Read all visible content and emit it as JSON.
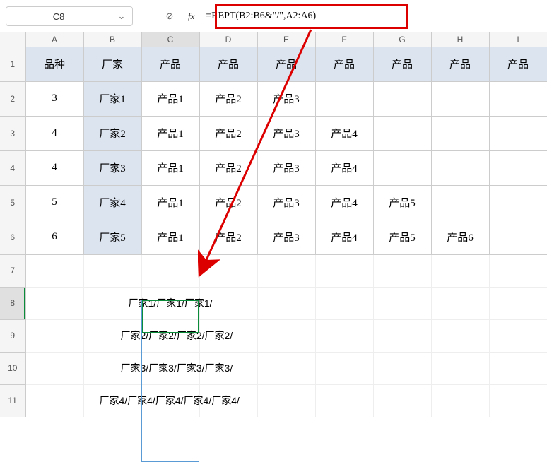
{
  "toolbar": {
    "cell_ref": "C8",
    "fx_label": "fx",
    "formula": "=REPT(B2:B6&\"/\",A2:A6)"
  },
  "columns": [
    "A",
    "B",
    "C",
    "D",
    "E",
    "F",
    "G",
    "H",
    "I"
  ],
  "rows": [
    "1",
    "2",
    "3",
    "4",
    "5",
    "6",
    "7",
    "8",
    "9",
    "10",
    "11"
  ],
  "headers": {
    "A": "品种",
    "B": "厂家",
    "C": "产品",
    "D": "产品",
    "E": "产品",
    "F": "产品",
    "G": "产品",
    "H": "产品",
    "I": "产品"
  },
  "data": [
    {
      "A": "3",
      "B": "厂家1",
      "C": "产品1",
      "D": "产品2",
      "E": "产品3",
      "F": "",
      "G": "",
      "H": "",
      "I": ""
    },
    {
      "A": "4",
      "B": "厂家2",
      "C": "产品1",
      "D": "产品2",
      "E": "产品3",
      "F": "产品4",
      "G": "",
      "H": "",
      "I": ""
    },
    {
      "A": "4",
      "B": "厂家3",
      "C": "产品1",
      "D": "产品2",
      "E": "产品3",
      "F": "产品4",
      "G": "",
      "H": "",
      "I": ""
    },
    {
      "A": "5",
      "B": "厂家4",
      "C": "产品1",
      "D": "产品2",
      "E": "产品3",
      "F": "产品4",
      "G": "产品5",
      "H": "",
      "I": ""
    },
    {
      "A": "6",
      "B": "厂家5",
      "C": "产品1",
      "D": "产品2",
      "E": "产品3",
      "F": "产品4",
      "G": "产品5",
      "H": "产品6",
      "I": ""
    }
  ],
  "spill": {
    "r8": "厂家1/厂家1/厂家1/",
    "r9": "厂家2/厂家2/厂家2/厂家2/",
    "r10": "厂家3/厂家3/厂家3/厂家3/",
    "r11": "厂家4/厂家4/厂家4/厂家4/厂家4/"
  },
  "icons": {
    "chevron": "⌄",
    "cancel": "⊘"
  },
  "chart_data": {
    "type": "table",
    "title": "",
    "columns": [
      "品种",
      "厂家",
      "产品",
      "产品",
      "产品",
      "产品",
      "产品",
      "产品",
      "产品"
    ],
    "rows": [
      [
        "3",
        "厂家1",
        "产品1",
        "产品2",
        "产品3",
        "",
        "",
        "",
        ""
      ],
      [
        "4",
        "厂家2",
        "产品1",
        "产品2",
        "产品3",
        "产品4",
        "",
        "",
        ""
      ],
      [
        "4",
        "厂家3",
        "产品1",
        "产品2",
        "产品3",
        "产品4",
        "",
        "",
        ""
      ],
      [
        "5",
        "厂家4",
        "产品1",
        "产品2",
        "产品3",
        "产品4",
        "产品5",
        "",
        ""
      ],
      [
        "6",
        "厂家5",
        "产品1",
        "产品2",
        "产品3",
        "产品4",
        "产品5",
        "产品6",
        ""
      ]
    ],
    "spill_values": [
      "厂家1/厂家1/厂家1/",
      "厂家2/厂家2/厂家2/厂家2/",
      "厂家3/厂家3/厂家3/厂家3/",
      "厂家4/厂家4/厂家4/厂家4/厂家4/"
    ],
    "formula": "=REPT(B2:B6&\"/\",A2:A6)"
  }
}
